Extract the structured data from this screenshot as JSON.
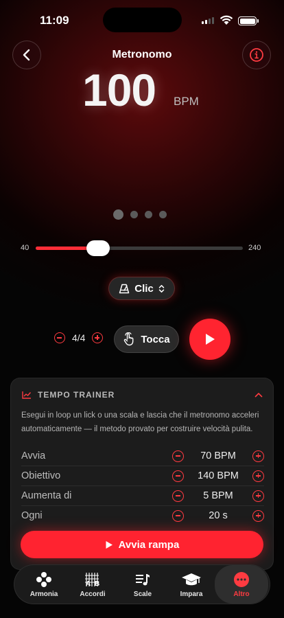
{
  "status_bar": {
    "time": "11:09"
  },
  "header": {
    "title": "Metronomo"
  },
  "tempo": {
    "bpm": "100",
    "unit": "BPM"
  },
  "beat_indicators": {
    "count": 4,
    "current": 1
  },
  "slider": {
    "min_label": "40",
    "max_label": "240",
    "value": 100,
    "min": 40,
    "max": 240
  },
  "sound": {
    "label": "Clic"
  },
  "time_signature": {
    "value": "4/4"
  },
  "tap": {
    "label": "Tocca"
  },
  "trainer": {
    "title": "TEMPO TRAINER",
    "description": "Esegui in loop un lick o una scala e lascia che il metronomo acceleri automaticamente — il metodo provato per costruire velocità pulita.",
    "rows": [
      {
        "label": "Avvia",
        "value": "70 BPM"
      },
      {
        "label": "Obiettivo",
        "value": "140 BPM"
      },
      {
        "label": "Aumenta di",
        "value": "5 BPM"
      },
      {
        "label": "Ogni",
        "value": "20 s"
      }
    ],
    "start_label": "Avvia rampa"
  },
  "tabs": [
    {
      "label": "Armonia",
      "icon": "circles-icon"
    },
    {
      "label": "Accordi",
      "icon": "guitar-icon"
    },
    {
      "label": "Scale",
      "icon": "notes-icon"
    },
    {
      "label": "Impara",
      "icon": "graduation-cap-icon"
    },
    {
      "label": "Altro",
      "icon": "more-icon",
      "active": true
    }
  ],
  "colors": {
    "accent": "#ff2430",
    "background": "#050505",
    "card": "#1c1c1c"
  }
}
